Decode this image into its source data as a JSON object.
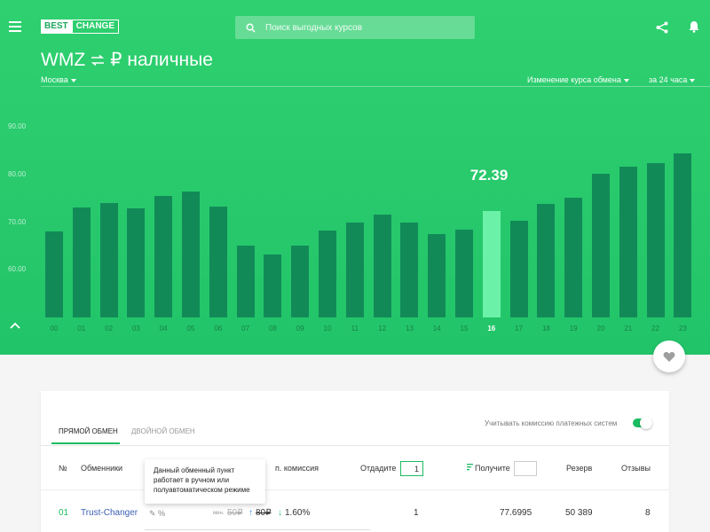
{
  "header": {
    "logo_part1": "BEST",
    "logo_part2": "CHANGE",
    "search_placeholder": "Поиск выгодных курсов"
  },
  "pair": {
    "from": "WMZ",
    "to": "₽ наличные",
    "city": "Москва",
    "rate_change_label": "Изменение курса обмена",
    "period_label": "за 24 часа"
  },
  "chart_data": {
    "type": "bar",
    "categories": [
      "00",
      "01",
      "02",
      "03",
      "04",
      "05",
      "06",
      "07",
      "08",
      "09",
      "10",
      "11",
      "12",
      "13",
      "14",
      "15",
      "16",
      "17",
      "18",
      "19",
      "20",
      "21",
      "22",
      "23"
    ],
    "values": [
      68.0,
      73.0,
      74.0,
      72.8,
      75.5,
      76.4,
      73.2,
      65.0,
      63.3,
      65.0,
      68.2,
      70.0,
      71.5,
      70.0,
      67.5,
      68.5,
      72.39,
      70.2,
      73.8,
      75.2,
      80.2,
      81.7,
      82.4,
      84.5
    ],
    "highlight_index": 16,
    "highlight_label": "72.39",
    "yticks": [
      "60.00",
      "70.00",
      "80.00",
      "90.00"
    ],
    "ylim": [
      50.0,
      90.0
    ],
    "colors": {
      "bar": "#128a58",
      "highlight": "#6cf2a8"
    }
  },
  "table": {
    "tabs": [
      "ПРЯМОЙ ОБМЕН",
      "ДВОЙНОЙ ОБМЕН"
    ],
    "commission_toggle_label": "Учитывать комиссию платежных систем",
    "commission_toggle_on": true,
    "headers": {
      "no": "№",
      "exchangers": "Обменники",
      "commission": "п. комиссия",
      "give": "Отдадите",
      "get": "Получите",
      "reserve": "Резерв",
      "reviews": "Отзывы"
    },
    "give_value": "1",
    "tooltip": "Данный обменный пункт работает в ручном или полуавтоматическом режиме",
    "rows": [
      {
        "rank": "01",
        "name": "Trust-Changer",
        "icons": "✎ %",
        "min_label": "мин.",
        "min_value": "50₽",
        "fee": "80₽",
        "percent": "1.60%",
        "give": "1",
        "get": "77.6995",
        "reserve": "50 389",
        "reviews": "8"
      }
    ]
  }
}
